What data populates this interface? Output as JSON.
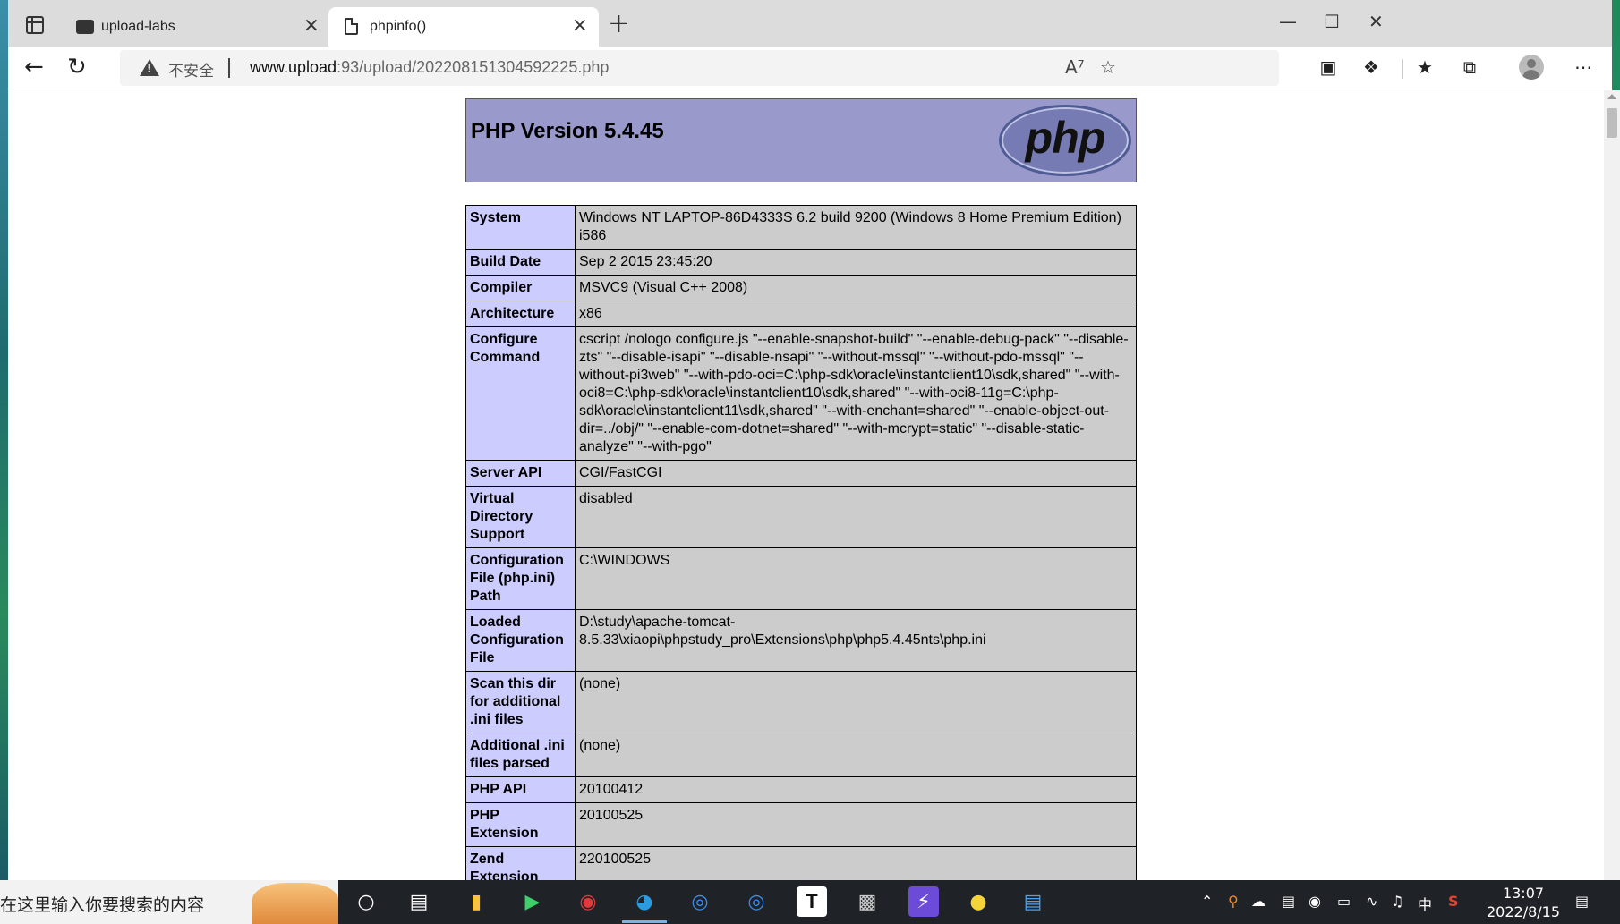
{
  "browser": {
    "tabs": [
      {
        "label": "upload-labs"
      },
      {
        "label": "phpinfo()"
      }
    ],
    "tab_close": "×",
    "new_tab": "+",
    "window_controls": {
      "minimize": "—",
      "maximize": "☐",
      "close": "✕"
    },
    "address": {
      "security_label": "不安全",
      "url_host": "www.upload",
      "url_rest": ":93/upload/202208151304592225.php"
    },
    "icons": [
      "back-icon",
      "refresh-icon",
      "read-aloud-icon",
      "add-favorite-icon",
      "extension-app-icon",
      "extensions-icon",
      "favorites-icon",
      "collections-icon",
      "profile-icon",
      "more-icon"
    ]
  },
  "phpinfo": {
    "title": "PHP Version 5.4.45",
    "logo_text": "php",
    "rows": [
      {
        "label": "System",
        "value": "Windows NT LAPTOP-86D4333S 6.2 build 9200 (Windows 8 Home Premium Edition) i586"
      },
      {
        "label": "Build Date",
        "value": "Sep 2 2015 23:45:20"
      },
      {
        "label": "Compiler",
        "value": "MSVC9 (Visual C++ 2008)"
      },
      {
        "label": "Architecture",
        "value": "x86"
      },
      {
        "label": "Configure Command",
        "value": "cscript /nologo configure.js \"--enable-snapshot-build\" \"--enable-debug-pack\" \"--disable-zts\" \"--disable-isapi\" \"--disable-nsapi\" \"--without-mssql\" \"--without-pdo-mssql\" \"--without-pi3web\" \"--with-pdo-oci=C:\\php-sdk\\oracle\\instantclient10\\sdk,shared\" \"--with-oci8=C:\\php-sdk\\oracle\\instantclient10\\sdk,shared\" \"--with-oci8-11g=C:\\php-sdk\\oracle\\instantclient11\\sdk,shared\" \"--with-enchant=shared\" \"--enable-object-out-dir=../obj/\" \"--enable-com-dotnet=shared\" \"--with-mcrypt=static\" \"--disable-static-analyze\" \"--with-pgo\""
      },
      {
        "label": "Server API",
        "value": "CGI/FastCGI"
      },
      {
        "label": "Virtual Directory Support",
        "value": "disabled"
      },
      {
        "label": "Configuration File (php.ini) Path",
        "value": "C:\\WINDOWS"
      },
      {
        "label": "Loaded Configuration File",
        "value": "D:\\study\\apache-tomcat-8.5.33\\xiaopi\\phpstudy_pro\\Extensions\\php\\php5.4.45nts\\php.ini"
      },
      {
        "label": "Scan this dir for additional .ini files",
        "value": "(none)"
      },
      {
        "label": "Additional .ini files parsed",
        "value": "(none)"
      },
      {
        "label": "PHP API",
        "value": "20100412"
      },
      {
        "label": "PHP Extension",
        "value": "20100525"
      },
      {
        "label": "Zend Extension",
        "value": "220100525"
      }
    ]
  },
  "taskbar": {
    "search_placeholder": "在这里输入你要搜索的内容",
    "ime": "中",
    "time": "13:07",
    "date": "2022/8/15",
    "apps": [
      "cortana-icon",
      "task-view-icon",
      "file-explorer-icon",
      "video-player-icon",
      "netease-music-icon",
      "edge-icon",
      "qq-browser-icon",
      "qq-icon",
      "typora-icon",
      "terminal-icon",
      "phpstudy-icon",
      "qq-music-icon",
      "app-window-icon"
    ]
  },
  "colors": {
    "php_header": "#9999cc",
    "php_label_cell": "#ccccff",
    "php_value_cell": "#cccccc"
  }
}
